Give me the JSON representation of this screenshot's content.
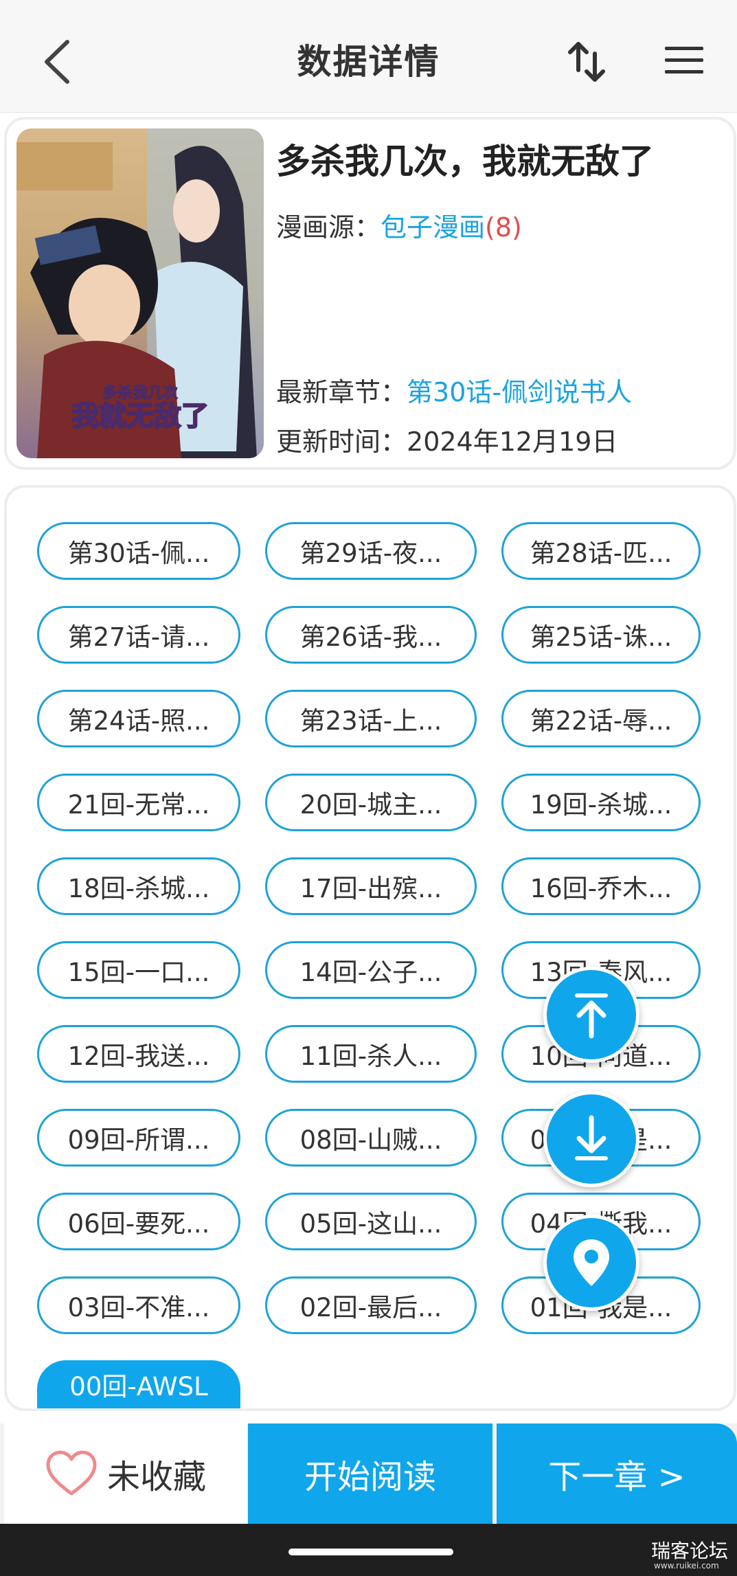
{
  "header": {
    "title": "数据详情",
    "back_icon": "chevron-left-icon",
    "sort_icon": "sort-arrows-icon",
    "menu_icon": "hamburger-menu-icon"
  },
  "comic": {
    "title": "多杀我几次，我就无敌了",
    "source_label": "漫画源：",
    "source_name": "包子漫画",
    "source_count": "(8)",
    "latest_label": "最新章节：",
    "latest_chapter": "第30话-佩剑说书人",
    "update_label": "更新时间：",
    "update_time": "2024年12月19日",
    "cover_text_line1": "多杀我几次",
    "cover_text_line2": "我就无敌了"
  },
  "chapters": [
    "第30话-佩...",
    "第29话-夜...",
    "第28话-匹...",
    "第27话-请...",
    "第26话-我...",
    "第25话-诛...",
    "第24话-照...",
    "第23话-上...",
    "第22话-辱...",
    "21回-无常...",
    "20回-城主...",
    "19回-杀城...",
    "18回-杀城...",
    "17回-出殡...",
    "16回-乔木...",
    "15回-一口...",
    "14回-公子...",
    "13回-春风...",
    "12回-我送...",
    "11回-杀人...",
    "10回-问道...",
    "09回-所谓...",
    "08回-山贼...",
    "07回-就是...",
    "06回-要死...",
    "05回-这山...",
    "04回-撕我...",
    "03回-不准...",
    "02回-最后...",
    "01回-我是...",
    "00回-AWSL"
  ],
  "active_chapter_index": 30,
  "fabs": {
    "top_icon": "scroll-to-top-icon",
    "bottom_icon": "scroll-to-bottom-icon",
    "locate_icon": "location-pin-icon"
  },
  "bottom": {
    "favorite_label": "未收藏",
    "read_label": "开始阅读",
    "next_label": "下一章 >"
  },
  "watermark": {
    "text": "瑞客论坛",
    "sub": "www.ruikei.com"
  },
  "colors": {
    "accent": "#0fa6ec",
    "chip_border": "#1ea2d8",
    "count_red": "#e24b4b",
    "heart": "#f08a8a"
  }
}
